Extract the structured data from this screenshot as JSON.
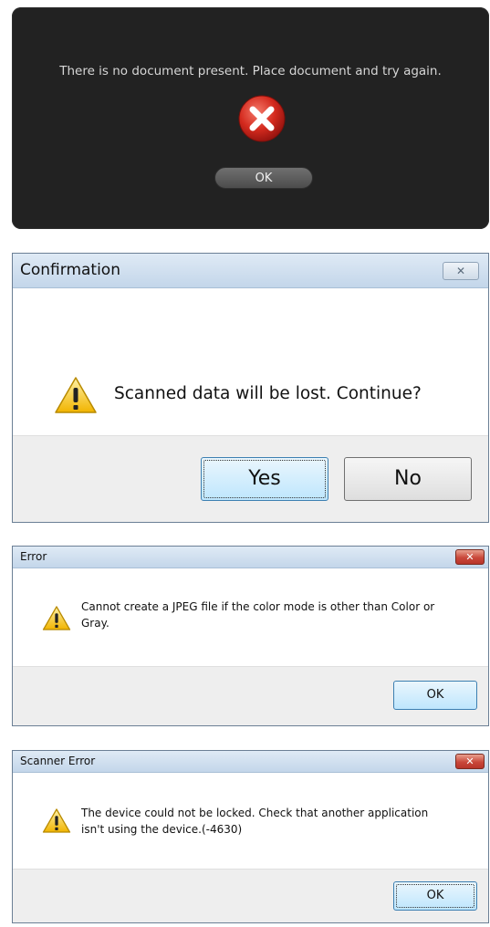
{
  "no_document_dialog": {
    "message": "There is no document present. Place document and try again.",
    "icon": "error-x-icon",
    "ok_label": "OK"
  },
  "confirmation_dialog": {
    "title": "Confirmation",
    "close_glyph": "✕",
    "icon": "warning-icon",
    "message": "Scanned data will be lost. Continue?",
    "yes_label": "Yes",
    "no_label": "No"
  },
  "error_dialog": {
    "title": "Error",
    "close_glyph": "✕",
    "icon": "warning-icon",
    "message_line1": "Cannot create a JPEG file if the color mode is other than Color or",
    "message_line2": "Gray.",
    "ok_label": "OK"
  },
  "scanner_error_dialog": {
    "title": "Scanner Error",
    "close_glyph": "✕",
    "icon": "warning-icon",
    "message_line1": "The device could not be locked.  Check that another application",
    "message_line2": "isn't using the device.(-4630)",
    "ok_label": "OK"
  },
  "colors": {
    "dark_bg": "#222222",
    "titlebar_blue": "#c3d6ea",
    "close_red": "#c9483a",
    "warning_yellow": "#f5c518",
    "error_red": "#d42a1e"
  }
}
